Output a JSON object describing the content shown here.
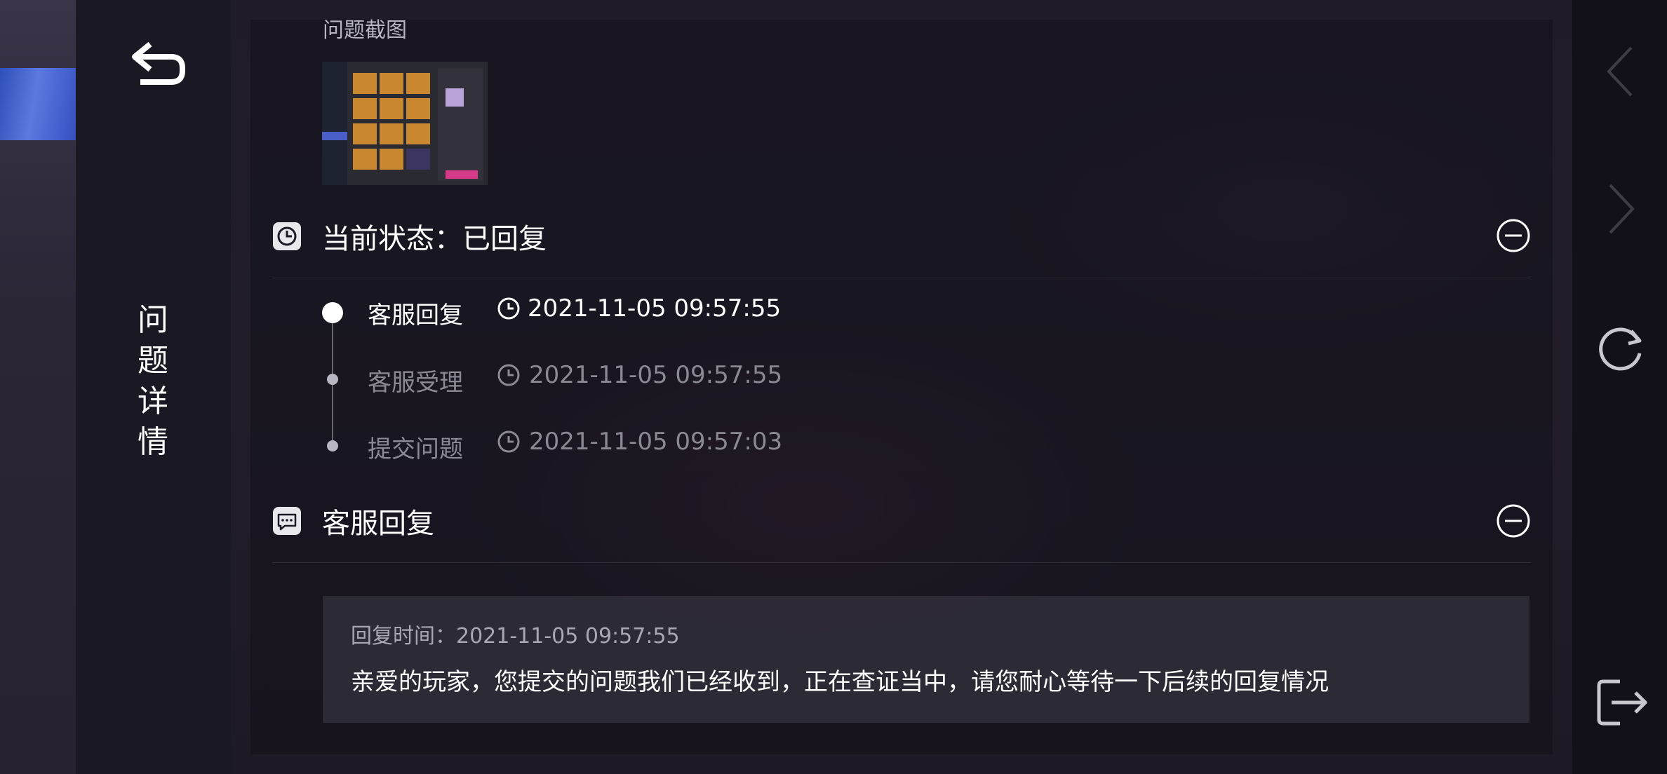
{
  "side": {
    "title_chars": [
      "问",
      "题",
      "详",
      "情"
    ]
  },
  "screenshot": {
    "label": "问题截图"
  },
  "status": {
    "title": "当前状态：已回复"
  },
  "timeline": [
    {
      "label": "客服回复",
      "time": "2021-11-05 09:57:55",
      "active": true
    },
    {
      "label": "客服受理",
      "time": "2021-11-05 09:57:55",
      "active": false
    },
    {
      "label": "提交问题",
      "time": "2021-11-05 09:57:03",
      "active": false
    }
  ],
  "reply": {
    "title": "客服回复",
    "time_line": "回复时间：2021-11-05 09:57:55",
    "message": "亲爱的玩家，您提交的问题我们已经收到，正在查证当中，请您耐心等待一下后续的回复情况"
  },
  "icons": {
    "back": "back-arrow-icon",
    "status": "clock-icon",
    "reply": "chat-bubble-icon",
    "collapse": "minus-circle-icon",
    "nav_back": "chevron-left-icon",
    "nav_forward": "chevron-right-icon",
    "refresh": "refresh-icon",
    "exit": "exit-icon"
  },
  "colors": {
    "background": "#1c1a24",
    "text_active": "#ffffff",
    "text_muted": "#8b8994",
    "accent_tab": "#4a6ad8"
  }
}
